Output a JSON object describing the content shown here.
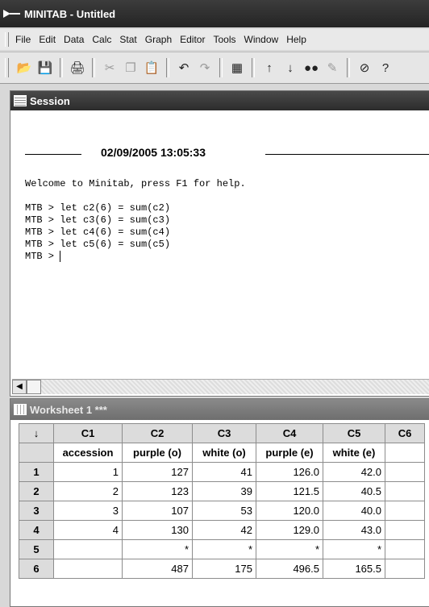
{
  "window": {
    "title": "MINITAB - Untitled"
  },
  "menu": [
    "File",
    "Edit",
    "Data",
    "Calc",
    "Stat",
    "Graph",
    "Editor",
    "Tools",
    "Window",
    "Help"
  ],
  "session": {
    "title": "Session",
    "timestamp": "02/09/2005 13:05:33",
    "welcome": "Welcome to Minitab, press F1 for help.",
    "commands": [
      "MTB > let c2(6) = sum(c2)",
      "MTB > let c3(6) = sum(c3)",
      "MTB > let c4(6) = sum(c4)",
      "MTB > let c5(6) = sum(c5)"
    ],
    "prompt": "MTB > "
  },
  "worksheet": {
    "title": "Worksheet 1 ***",
    "corner": "↓",
    "columns": [
      "C1",
      "C2",
      "C3",
      "C4",
      "C5",
      "C6"
    ],
    "names": [
      "accession",
      "purple (o)",
      "white (o)",
      "purple (e)",
      "white (e)",
      ""
    ],
    "rows": [
      {
        "id": "1",
        "cells": [
          "1",
          "127",
          "41",
          "126.0",
          "42.0",
          ""
        ]
      },
      {
        "id": "2",
        "cells": [
          "2",
          "123",
          "39",
          "121.5",
          "40.5",
          ""
        ]
      },
      {
        "id": "3",
        "cells": [
          "3",
          "107",
          "53",
          "120.0",
          "40.0",
          ""
        ]
      },
      {
        "id": "4",
        "cells": [
          "4",
          "130",
          "42",
          "129.0",
          "43.0",
          ""
        ]
      },
      {
        "id": "5",
        "cells": [
          "",
          "*",
          "*",
          "*",
          "*",
          ""
        ]
      },
      {
        "id": "6",
        "cells": [
          "",
          "487",
          "175",
          "496.5",
          "165.5",
          ""
        ]
      }
    ]
  },
  "toolbar": [
    "open-icon",
    "save-icon",
    "print-icon",
    "cut-icon",
    "copy-icon",
    "paste-icon",
    "undo-icon",
    "redo-icon",
    "session-window-icon",
    "up-arrow-icon",
    "down-arrow-icon",
    "find-icon",
    "replace-icon",
    "cancel-icon",
    "help-icon"
  ]
}
